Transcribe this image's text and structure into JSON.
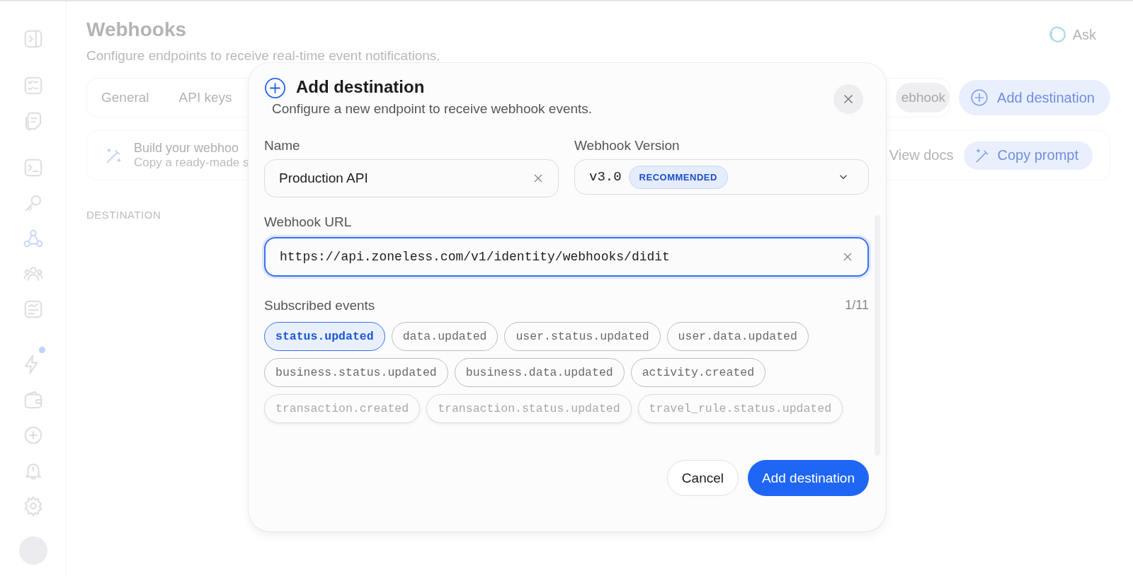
{
  "page": {
    "title": "Webhooks",
    "subtitle": "Configure endpoints to receive real-time event notifications.",
    "ask_button": "Ask",
    "tabs": [
      {
        "label": "General",
        "selected": false
      },
      {
        "label": "API keys",
        "selected": false
      },
      {
        "label": "ebhook",
        "selected": true
      }
    ],
    "add_button": "Add destination",
    "banner": {
      "title": "Build your webhoo",
      "subtitle": "Copy a ready-made s",
      "docs_link": "View docs",
      "copy_button": "Copy prompt"
    },
    "section_label": "DESTINATION"
  },
  "modal": {
    "title": "Add destination",
    "description": "Configure a new endpoint to receive webhook events.",
    "name": {
      "label": "Name",
      "value": "Production API"
    },
    "version": {
      "label": "Webhook Version",
      "value": "v3.0",
      "badge": "RECOMMENDED"
    },
    "url": {
      "label": "Webhook URL",
      "value": "https://api.zoneless.com/v1/identity/webhooks/didit"
    },
    "events": {
      "label": "Subscribed events",
      "count": "1/11",
      "items": [
        {
          "label": "status.updated",
          "selected": true
        },
        {
          "label": "data.updated",
          "selected": false
        },
        {
          "label": "user.status.updated",
          "selected": false
        },
        {
          "label": "user.data.updated",
          "selected": false
        },
        {
          "label": "business.status.updated",
          "selected": false
        },
        {
          "label": "business.data.updated",
          "selected": false
        },
        {
          "label": "activity.created",
          "selected": false
        },
        {
          "label": "transaction.created",
          "selected": false
        },
        {
          "label": "transaction.status.updated",
          "selected": false
        },
        {
          "label": "travel_rule.status.updated",
          "selected": false
        }
      ]
    },
    "cancel_button": "Cancel",
    "confirm_button": "Add destination"
  }
}
